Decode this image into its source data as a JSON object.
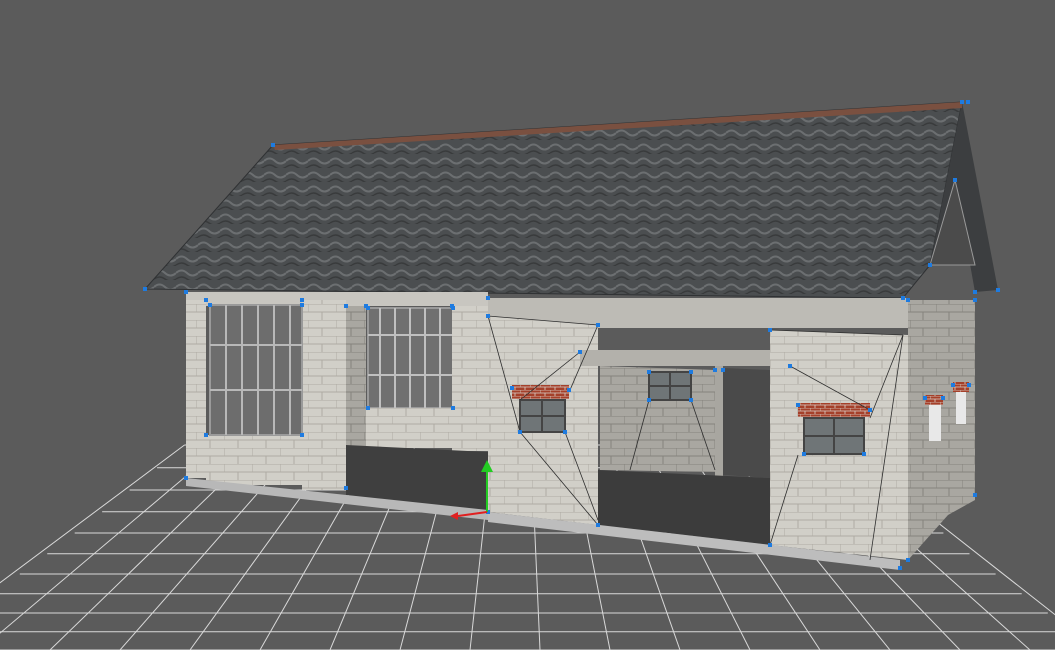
{
  "viewport": {
    "background": "#5b5b5b",
    "grid_color": "#d9d9d9",
    "selection_color": "#1e7be0",
    "axis_y_color": "#22cc22",
    "axis_x_color": "#e02020"
  },
  "model": {
    "roof_color": "#4a4d4e",
    "wall_color": "#cfcdc7",
    "floor_color": "#3f3f3f",
    "brick_color": "#a5402a",
    "window_frame_color": "#8a8a8a",
    "icons": [
      "move-gizmo-y-arrow-icon",
      "move-gizmo-x-arrow-icon"
    ]
  }
}
